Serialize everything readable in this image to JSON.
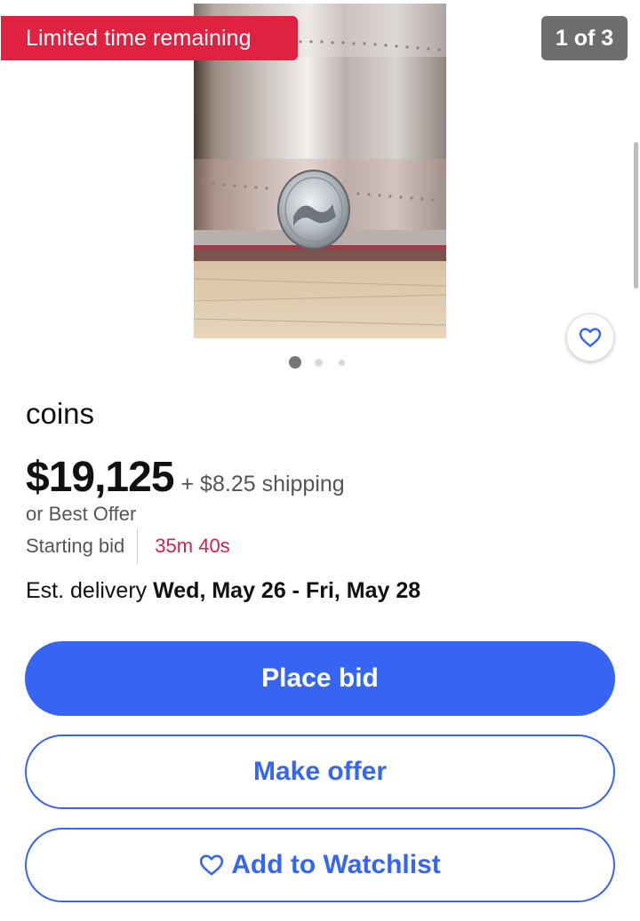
{
  "gallery": {
    "badge": "Limited time remaining",
    "counter": "1 of 3",
    "photo_count": 3,
    "active_index": 0
  },
  "listing": {
    "title": "coins",
    "price": "$19,125",
    "shipping": "+ $8.25 shipping",
    "best_offer": "or Best Offer",
    "starting_bid": "Starting bid",
    "time_left": "35m 40s",
    "delivery_label": "Est. delivery",
    "delivery_dates": "Wed, May 26 - Fri, May 28"
  },
  "actions": {
    "place_bid": "Place bid",
    "make_offer": "Make offer",
    "watchlist": "Add to Watchlist"
  },
  "colors": {
    "accent": "#3665f3",
    "badge": "#e0213f",
    "timer": "#d1234a"
  },
  "icons": {
    "watch": "heart-icon"
  }
}
